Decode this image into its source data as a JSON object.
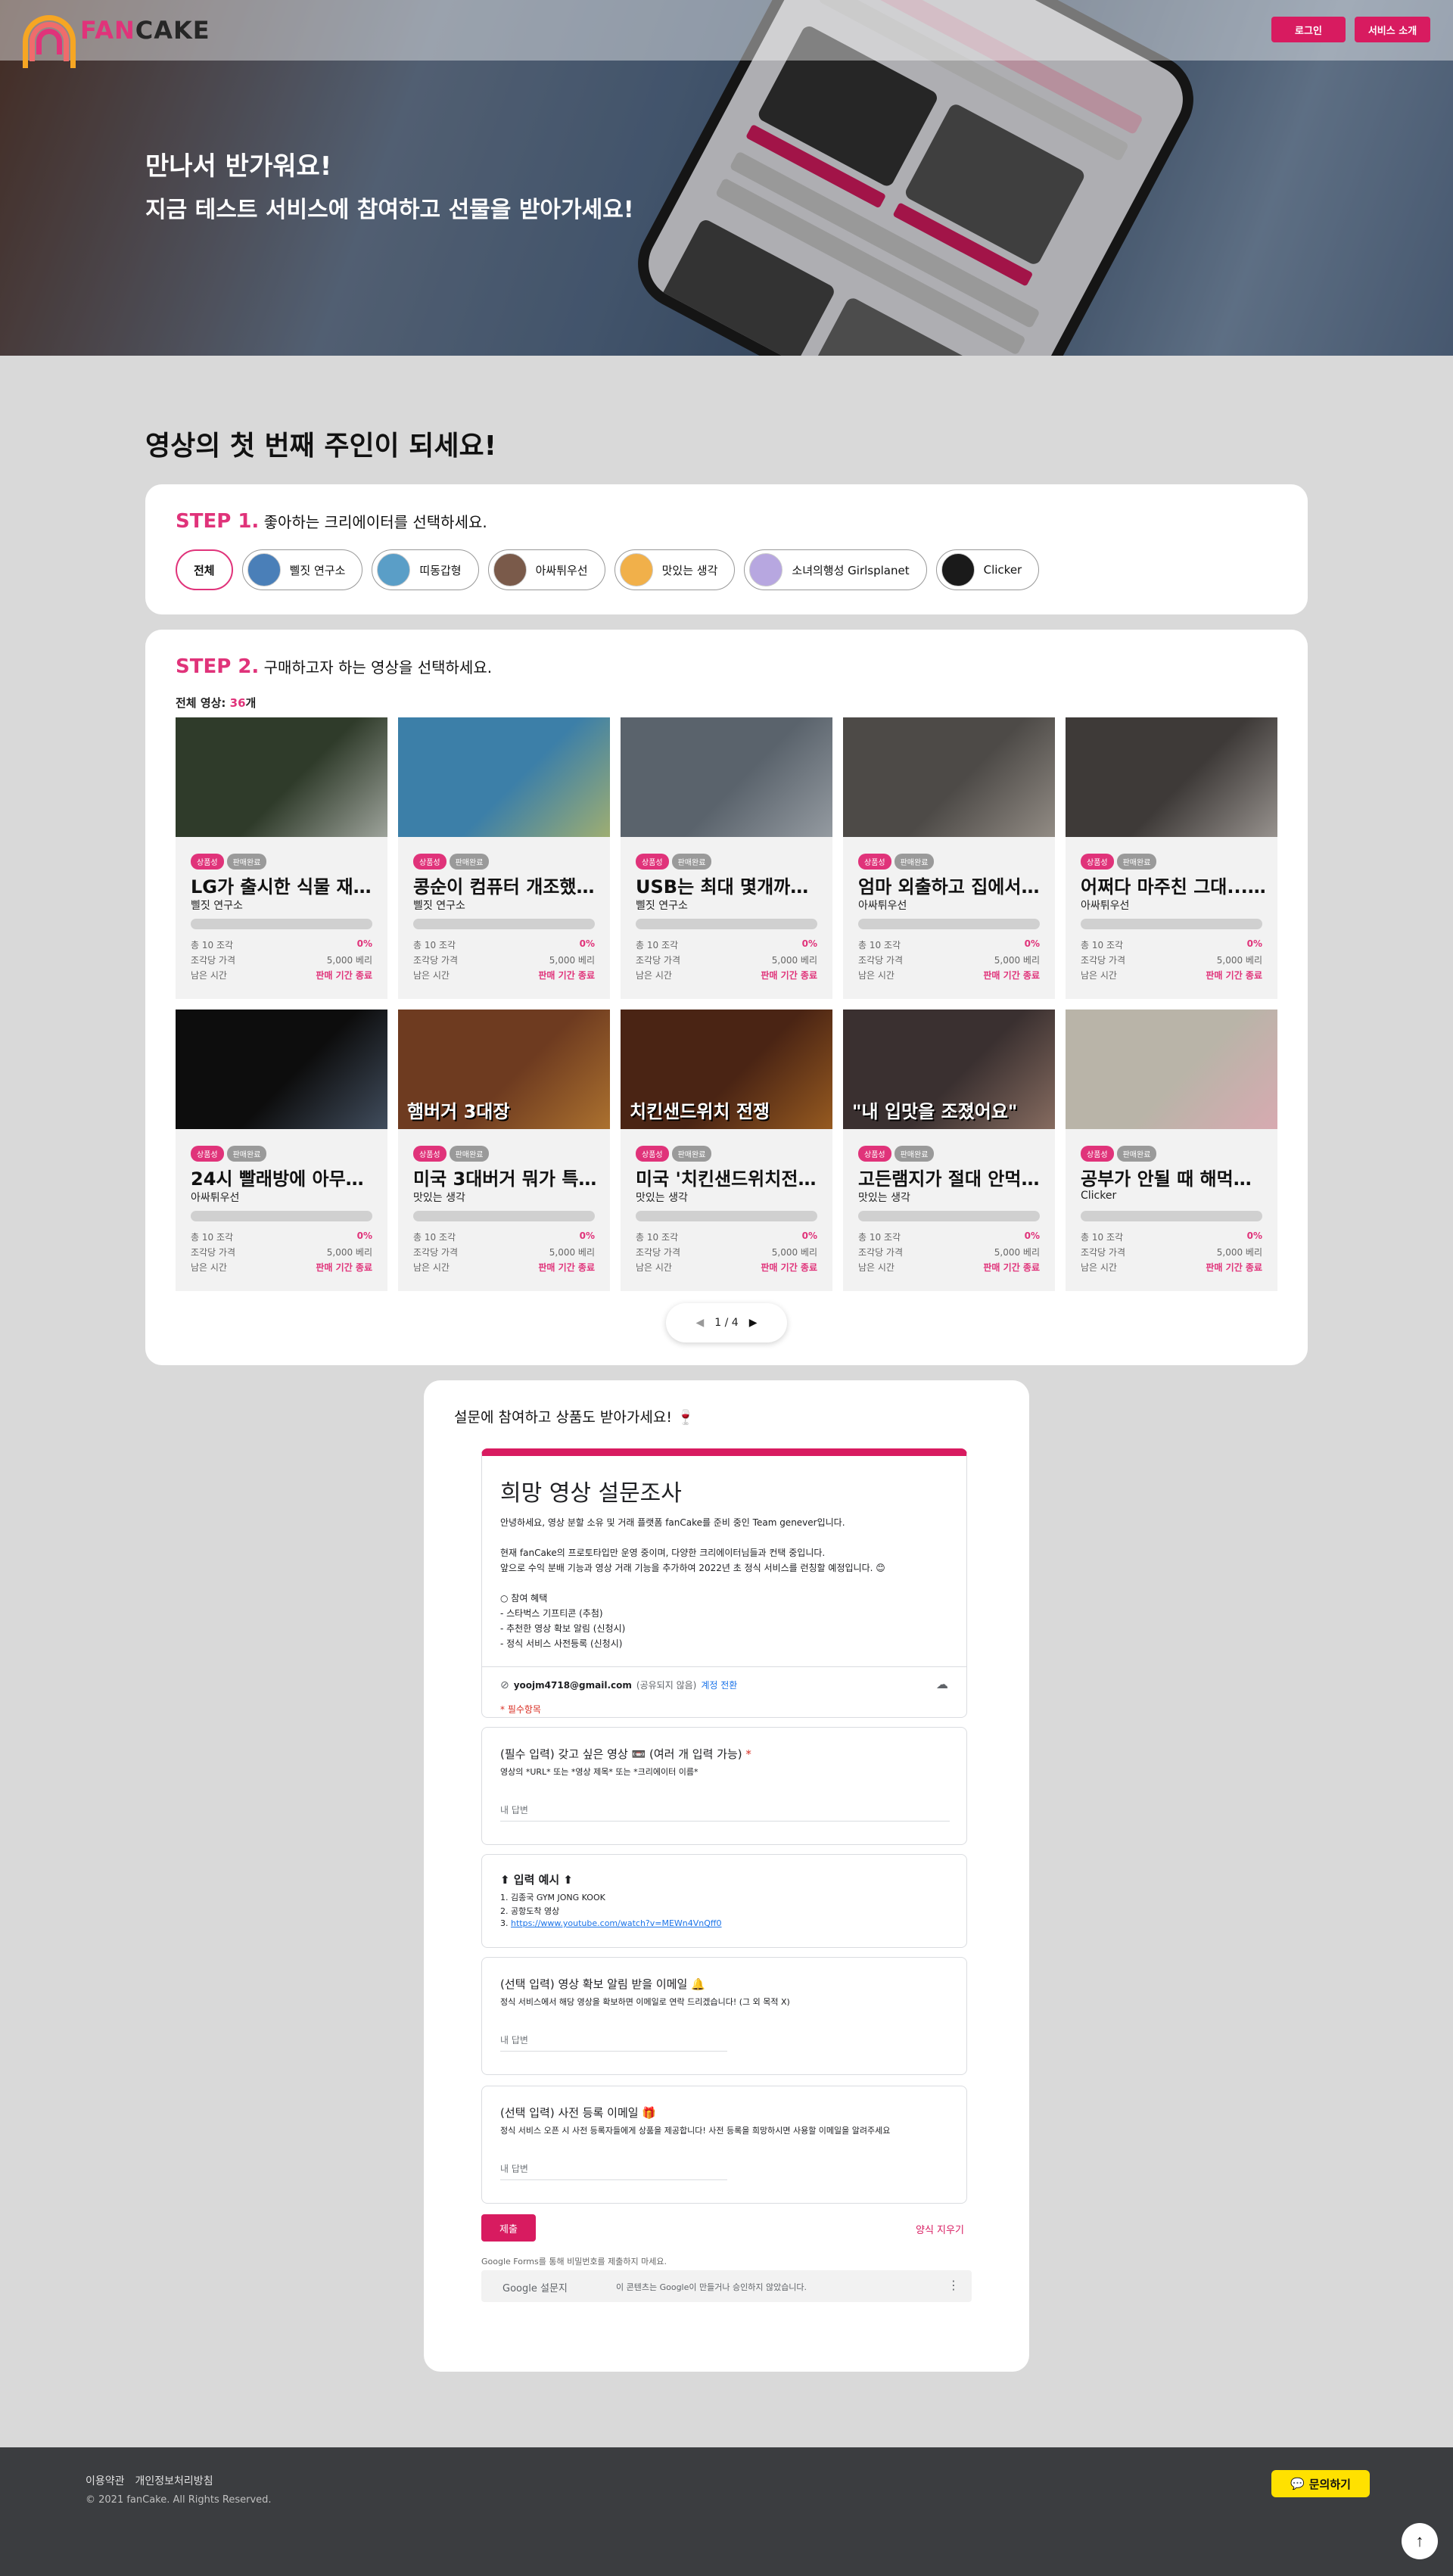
{
  "header": {
    "logo_fan": "FAN",
    "logo_cake": "CAKE",
    "login_label": "로그인",
    "intro_label": "서비스 소개"
  },
  "hero": {
    "title": "만나서 반가워요!",
    "subtitle": "지금 테스트 서비스에 참여하고 선물을 받아가세요!"
  },
  "main": {
    "section_title": "영상의 첫 번째 주인이 되세요!"
  },
  "step1": {
    "num": "STEP 1.",
    "text": "좋아하는 크리에이터를 선택하세요.",
    "chips": [
      {
        "label": "전체",
        "active": true,
        "color": ""
      },
      {
        "label": "삘짓 연구소",
        "active": false,
        "color": "#4a7fb8"
      },
      {
        "label": "띠동갑형",
        "active": false,
        "color": "#5a9ec7"
      },
      {
        "label": "아싸튀우선",
        "active": false,
        "color": "#7a5a4a"
      },
      {
        "label": "맛있는 생각",
        "active": false,
        "color": "#f1b04a"
      },
      {
        "label": "소녀의행성 Girlsplanet",
        "active": false,
        "color": "#b7a7e0"
      },
      {
        "label": "Clicker",
        "active": false,
        "color": "#1a1a1a"
      }
    ]
  },
  "step2": {
    "num": "STEP 2.",
    "text": "구매하고자 하는 영상을 선택하세요.",
    "total_label": "전체 영상: ",
    "total_count": "36",
    "total_unit": "개",
    "labels": {
      "badge1": "상품성",
      "badge2": "판매완료",
      "pieces": "총 10 조각",
      "percent": "0%",
      "price_label": "조각당 가격",
      "price": "5,000 베리",
      "remain_label": "남은 시간",
      "ended": "판매 기간 종료"
    },
    "videos": [
      {
        "title": "LG가 출시한 식물 재배...",
        "creator": "삘짓 연구소",
        "thumb_text": "",
        "bg": "#2f3b2a",
        "accent": "#ffffff"
      },
      {
        "title": "콩순이 컴퓨터 개조했습...",
        "creator": "삘짓 연구소",
        "thumb_text": "",
        "bg": "#3c7fa8",
        "accent": "#f5d742"
      },
      {
        "title": "USB는 최대 몇개까지 ...",
        "creator": "삘짓 연구소",
        "thumb_text": "",
        "bg": "#5a636c",
        "accent": "#c8ccd0"
      },
      {
        "title": "엄마 외출하고 집에서 혼...",
        "creator": "아싸튀우선",
        "thumb_text": "",
        "bg": "#4d4a47",
        "accent": "#cfc6bb"
      },
      {
        "title": "어쩌다 마주친 그대... ...",
        "creator": "아싸튀우선",
        "thumb_text": "",
        "bg": "#3e3a38",
        "accent": "#e6e0da"
      },
      {
        "title": "24시 빨래방에 아무도 ...",
        "creator": "아싸튀우선",
        "thumb_text": "",
        "bg": "#0d0d0d",
        "accent": "#6f86a5"
      },
      {
        "title": "미국 3대버거 뭐가 특별...",
        "creator": "맛있는 생각",
        "thumb_text": "햄버거 3대장",
        "bg": "#6e3b20",
        "accent": "#e2a13c"
      },
      {
        "title": "미국 '치킨샌드위치전쟁...",
        "creator": "맛있는 생각",
        "thumb_text": "치킨샌드위치 전쟁",
        "bg": "#4a2414",
        "accent": "#d98a2b"
      },
      {
        "title": "고든램지가 절대 안먹는 ...",
        "creator": "맛있는 생각",
        "thumb_text": "\"내 입맛을 조졌어요\"",
        "bg": "#3a3030",
        "accent": "#c9a08a"
      },
      {
        "title": "공부가 안될 때 해먹는 ...",
        "creator": "Clicker",
        "thumb_text": "",
        "bg": "#b9b4a8",
        "accent": "#f2a1b8"
      }
    ],
    "page": "1 / 4"
  },
  "survey": {
    "heading": "설문에 참여하고 상품도 받아가세요! 🍷",
    "form_title": "희망 영상 설문조사",
    "body_lines": [
      "안녕하세요, 영상 분할 소유 및 거래 플랫폼 fanCake를 준비 중인 Team genever입니다.",
      "",
      "현재 fanCake의 프로토타입만 운영 중이며, 다양한 크리에이터님들과 컨택 중입니다.",
      "앞으로 수익 분배 기능과 영상 거래 기능을 추가하여 2022년 초 정식 서비스를 런칭할 예정입니다. 😊",
      "",
      "○ 참여 혜택",
      "- 스타벅스 기프티콘 (추첨)",
      "- 추천한 영상 확보 알림 (신청시)",
      "- 정식 서비스 사전등록 (신청시)"
    ],
    "account": "yoojm4718@gmail.com",
    "account_note": "(공유되지 않음)",
    "switch_account": "계정 전환",
    "required_note": "* 필수항목",
    "q1_title": "(필수 입력) 갖고 싶은 영상 📼 (여러 개 입력 가능)",
    "q1_desc": "영상의 *URL* 또는 *영상 제목* 또는 *크리에이터 이름*",
    "answer_placeholder": "내 답변",
    "example_title": "⬆ 입력 예시 ⬆",
    "example_1": "1. 김종국 GYM JONG KOOK",
    "example_2": "2. 공항도착 영상",
    "example_3_prefix": "3. ",
    "example_3_link": "https://www.youtube.com/watch?v=MEWn4VnQff0",
    "q2_title": "(선택 입력) 영상 확보 알림 받을 이메일 🔔",
    "q2_desc": "정식 서비스에서 해당 영상을 확보하면 이메일로 연락 드리겠습니다! (그 외 목적 X)",
    "q3_title": "(선택 입력) 사전 등록 이메일 🎁",
    "q3_desc": "정식 서비스 오픈 시 사전 등록자들에게 상품을 제공합니다! 사전 등록을 희망하시면 사용할 이메일을 알려주세요",
    "submit": "제출",
    "clear": "양식 지우기",
    "never_submit": "Google Forms를 통해 비밀번호를 제출하지 마세요.",
    "google_forms_google": "Google",
    "google_forms_label": "설문지",
    "disclaimer": "이 콘텐츠는 Google이 만들거나 승인하지 않았습니다."
  },
  "footer": {
    "terms": "이용약관",
    "privacy": "개인정보처리방침",
    "copyright": "© 2021 fanCake. All Rights Reserved.",
    "inquiry": "문의하기"
  },
  "colors": {
    "brand": "#d81b60",
    "accent": "#e0337a",
    "kakao": "#ffe100",
    "footer_bg": "#3b3d40"
  }
}
